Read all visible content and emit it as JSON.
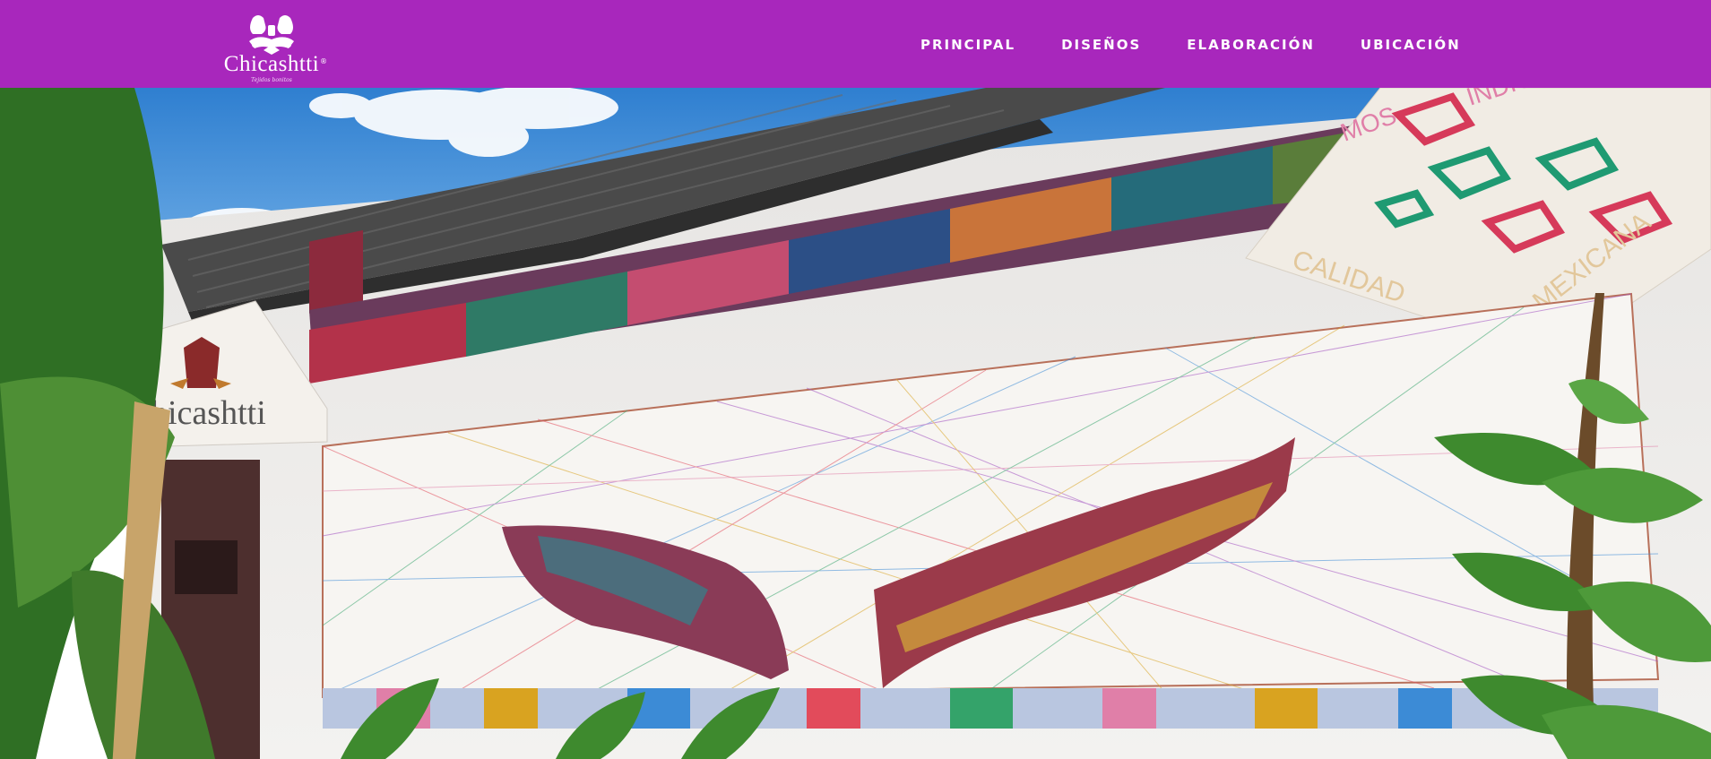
{
  "brand": {
    "name": "Chicashtti",
    "reg_mark": "®",
    "tagline": "Tejidos bonitos",
    "logo_icon": "woven-birds-logo-icon"
  },
  "nav": {
    "items": [
      {
        "label": "PRINCIPAL"
      },
      {
        "label": "DISEÑOS"
      },
      {
        "label": "ELABORACIÓN"
      },
      {
        "label": "UBICACIÓN"
      }
    ]
  },
  "hero": {
    "shop_sign_text": "hicashtti",
    "banner_lines": [
      "INDIGENAS",
      "MOS",
      "MEXICANA",
      "CALIDAD"
    ]
  },
  "colors": {
    "navbar_bg": "#a827bc",
    "nav_text": "#ffffff",
    "sky": "#3f8fd6",
    "wall": "#eeecea",
    "roof": "#4a4a4a"
  }
}
